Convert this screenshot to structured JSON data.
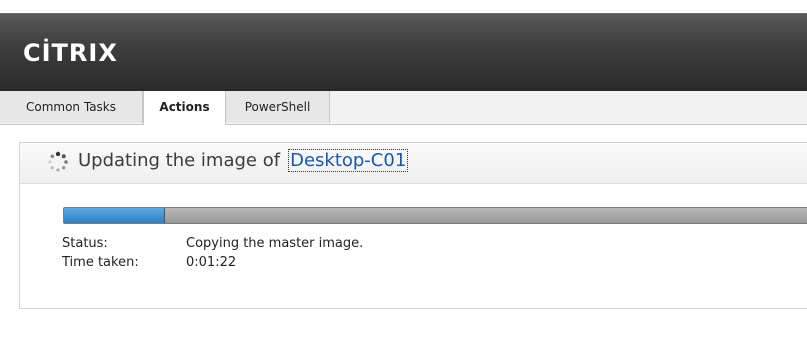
{
  "header": {
    "logo_text": "CİTRIX"
  },
  "tabs": [
    {
      "label": "Common Tasks",
      "active": false
    },
    {
      "label": "Actions",
      "active": true
    },
    {
      "label": "PowerShell",
      "active": false
    }
  ],
  "task": {
    "title_prefix": "Updating the image of",
    "target_link": "Desktop-C01",
    "progress": 0.13,
    "status_label": "Status:",
    "status_value": "Copying the master image.",
    "time_label": "Time taken:",
    "time_value": "0:01:22"
  },
  "colors": {
    "header_bg": "#3a3a3a",
    "link": "#1a58a8",
    "progress_fill": "#3a8fd0",
    "progress_track": "#a8a8a8"
  },
  "icons": {
    "spinner": "loading-spinner-icon"
  }
}
